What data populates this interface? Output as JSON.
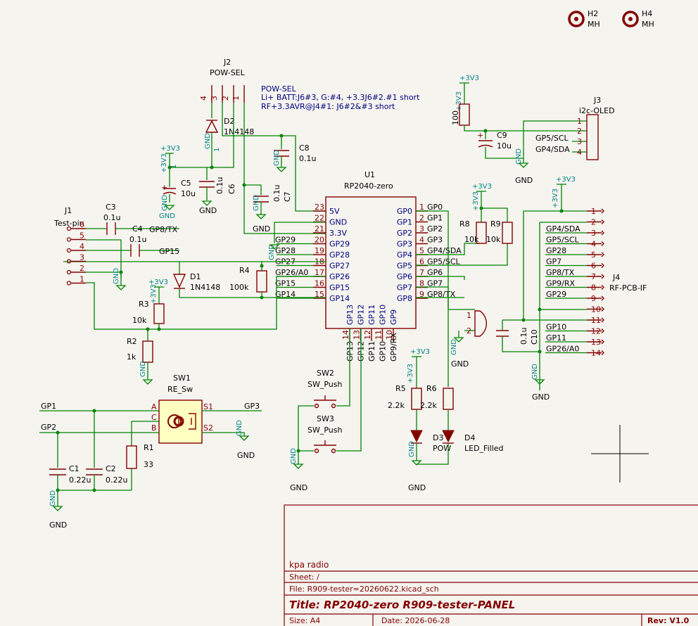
{
  "note": {
    "line1": "POW-SEL",
    "line2": "Li+ BATT:J6#3, G:#4, +3.3J6#2.#1 short",
    "line3": "RF+3.3AVR@J4#1: J6#2&#3 short"
  },
  "mounting_holes": [
    {
      "ref": "H2",
      "value": "MH"
    },
    {
      "ref": "H4",
      "value": "MH"
    }
  ],
  "u1": {
    "ref": "U1",
    "value": "RP2040-zero",
    "left_pins": [
      {
        "num": "23",
        "name": "5V"
      },
      {
        "num": "22",
        "name": "GND"
      },
      {
        "num": "21",
        "name": "3.3V"
      },
      {
        "num": "20",
        "name": "GP29"
      },
      {
        "num": "19",
        "name": "GP28"
      },
      {
        "num": "18",
        "name": "GP27"
      },
      {
        "num": "17",
        "name": "GP26"
      },
      {
        "num": "16",
        "name": "GP15"
      },
      {
        "num": "15",
        "name": "GP14"
      }
    ],
    "right_pins": [
      {
        "num": "1",
        "name": "GP0"
      },
      {
        "num": "2",
        "name": "GP1"
      },
      {
        "num": "3",
        "name": "GP2"
      },
      {
        "num": "4",
        "name": "GP3"
      },
      {
        "num": "5",
        "name": "GP4"
      },
      {
        "num": "6",
        "name": "GP5"
      },
      {
        "num": "7",
        "name": "GP6"
      },
      {
        "num": "8",
        "name": "GP7"
      },
      {
        "num": "9",
        "name": "GP8"
      }
    ],
    "bottom_pins": [
      {
        "num": "14",
        "name": "GP13"
      },
      {
        "num": "13",
        "name": "GP12"
      },
      {
        "num": "12",
        "name": "GP11"
      },
      {
        "num": "11",
        "name": "GP10"
      },
      {
        "num": "10",
        "name": "GP9"
      }
    ]
  },
  "u1_net_labels": {
    "left": [
      "GP29",
      "GP28",
      "GP27",
      "GP26/A0",
      "GP15",
      "GP14"
    ],
    "right": [
      "GP0",
      "GP1",
      "GP2",
      "GP3",
      "GP4/SDA",
      "GP5/SCL",
      "GP6",
      "GP7",
      "GP8/TX"
    ],
    "bottom": [
      "GP13",
      "GP12",
      "GP11",
      "GP10",
      "GP9/RX"
    ]
  },
  "j2": {
    "ref": "J2",
    "value": "POW-SEL",
    "pins": [
      "4",
      "3",
      "2",
      "1"
    ]
  },
  "j1": {
    "ref": "J1",
    "value": "Test-pin",
    "pins": [
      "6",
      "5",
      "4",
      "3",
      "2",
      "1"
    ]
  },
  "j1_labels": [
    "GP8/TX",
    "GP15"
  ],
  "j3": {
    "ref": "J3",
    "value": "i2c-OLED",
    "pins": [
      "1",
      "2",
      "3",
      "4"
    ],
    "labels": [
      "GP5/SCL",
      "GP4/SDA"
    ]
  },
  "j4": {
    "ref": "J4",
    "value": "RF-PCB-IF",
    "pins": [
      "1",
      "2",
      "3",
      "4",
      "5",
      "6",
      "7",
      "8",
      "9",
      "10",
      "11",
      "12",
      "13",
      "14"
    ],
    "labels": [
      "GP4/SDA",
      "GP5/SCL",
      "GP28",
      "GP7",
      "GP8/TX",
      "GP9/RX",
      "GP29",
      "GP10",
      "GP11",
      "GP26/A0"
    ]
  },
  "components": {
    "c3": {
      "ref": "C3",
      "value": "0.1u"
    },
    "c4": {
      "ref": "C4",
      "value": "0.1u"
    },
    "c5": {
      "ref": "C5",
      "value": "10u"
    },
    "c6": {
      "ref": "C6",
      "value": "0.1u"
    },
    "c7": {
      "ref": "C7",
      "value": "0.1u"
    },
    "c8": {
      "ref": "C8",
      "value": "0.1u"
    },
    "c9": {
      "ref": "C9",
      "value": "10u"
    },
    "c10": {
      "ref": "C10",
      "value": "0.1u"
    },
    "c1": {
      "ref": "C1",
      "value": "0.22u"
    },
    "c2": {
      "ref": "C2",
      "value": "0.22u"
    },
    "d1": {
      "ref": "D1",
      "value": "1N4148"
    },
    "d2": {
      "ref": "D2",
      "value": "1N4148"
    },
    "r1": {
      "ref": "R1",
      "value": "33"
    },
    "r2": {
      "ref": "R2",
      "value": "1k"
    },
    "r3": {
      "ref": "R3",
      "value": "10k"
    },
    "r4": {
      "ref": "R4",
      "value": "100k"
    },
    "r5": {
      "ref": "R5",
      "value": "2.2k"
    },
    "r6": {
      "ref": "R6",
      "value": "2.2k"
    },
    "r8": {
      "ref": "R8",
      "value": "10k"
    },
    "r9": {
      "ref": "R9",
      "value": "10k"
    },
    "r100": {
      "value": "100"
    },
    "d3": {
      "ref": "D3",
      "value": "POW"
    },
    "d4": {
      "ref": "D4",
      "value": "LED_Filled"
    },
    "sw1": {
      "ref": "SW1",
      "value": "RE_Sw",
      "pins": [
        "A",
        "C",
        "B",
        "S1",
        "S2"
      ]
    },
    "sw2": {
      "ref": "SW2",
      "value": "SW_Push"
    },
    "sw3": {
      "ref": "SW3",
      "value": "SW_Push"
    }
  },
  "sw1_labels": [
    "GP1",
    "GP2",
    "GP3"
  ],
  "power": {
    "gnd": "GND",
    "v33": "+3V3"
  },
  "power_pin": "1",
  "buzzer_pins": [
    "1",
    "2"
  ],
  "title_block": {
    "company": "kpa radio",
    "sheet": "Sheet: /",
    "file": "File: R909-tester=20260622.kicad_sch",
    "title": "Title: RP2040-zero R909-tester-PANEL",
    "size": "Size: A4",
    "date": "Date: 2026-06-28",
    "rev": "Rev: V1.0"
  }
}
